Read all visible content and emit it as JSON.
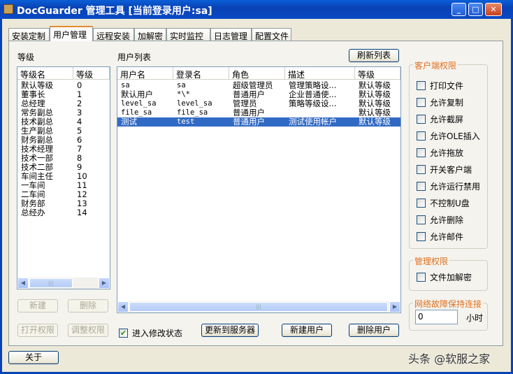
{
  "window": {
    "title": "DocGuarder 管理工具 [当前登录用户:sa]"
  },
  "tabs": [
    {
      "label": "安装定制"
    },
    {
      "label": "用户管理"
    },
    {
      "label": "远程安装"
    },
    {
      "label": "加解密"
    },
    {
      "label": "实时监控"
    },
    {
      "label": "日志管理"
    },
    {
      "label": "配置文件"
    }
  ],
  "levels": {
    "label": "等级",
    "columns": [
      "等级名",
      "等级"
    ],
    "rows": [
      [
        "默认等级",
        "0"
      ],
      [
        "董事长",
        "1"
      ],
      [
        "总经理",
        "2"
      ],
      [
        "常务副总",
        "3"
      ],
      [
        "技术副总",
        "4"
      ],
      [
        "生产副总",
        "5"
      ],
      [
        "财务副总",
        "6"
      ],
      [
        "技术经理",
        "7"
      ],
      [
        "技术一部",
        "8"
      ],
      [
        "技术二部",
        "9"
      ],
      [
        "车间主任",
        "10"
      ],
      [
        "一车间",
        "11"
      ],
      [
        "二车间",
        "12"
      ],
      [
        "财务部",
        "13"
      ],
      [
        "总经办",
        "14"
      ]
    ],
    "new_label": "新建",
    "delete_label": "删除",
    "open_perm_label": "打开权限",
    "adjust_perm_label": "调整权限"
  },
  "users": {
    "label": "用户列表",
    "refresh_label": "刷新列表",
    "columns": [
      "用户名",
      "登录名",
      "角色",
      "描述",
      "等级"
    ],
    "rows": [
      [
        "sa",
        "sa",
        "超级管理员",
        "管理策略设...",
        "默认等级"
      ],
      [
        "默认用户",
        "*\\*",
        "普通用户",
        "企业普通使...",
        "默认等级"
      ],
      [
        "level_sa",
        "level_sa",
        "管理员",
        "策略等级设...",
        "默认等级"
      ],
      [
        "file_sa",
        "file_sa",
        "普通用户",
        "",
        "默认等级"
      ],
      [
        "测试",
        "test",
        "普通用户",
        "测试使用帐户",
        "默认等级"
      ]
    ],
    "selected_index": 4,
    "edit_mode_label": "进入修改状态",
    "edit_mode_checked": true,
    "update_label": "更新到服务器",
    "new_user_label": "新建用户",
    "delete_user_label": "删除用户"
  },
  "client_perms": {
    "title": "客户端权限",
    "items": [
      "打印文件",
      "允许复制",
      "允许截屏",
      "允许OLE插入",
      "允许拖放",
      "开关客户端",
      "允许运行禁用",
      "不控制U盘",
      "允许删除",
      "允许邮件"
    ]
  },
  "admin_perms": {
    "title": "管理权限",
    "items": [
      "文件加解密"
    ]
  },
  "network": {
    "title": "网络故障保持连接",
    "value": "0",
    "unit": "小时"
  },
  "about_label": "关于",
  "watermark": "头条 @软服之家"
}
